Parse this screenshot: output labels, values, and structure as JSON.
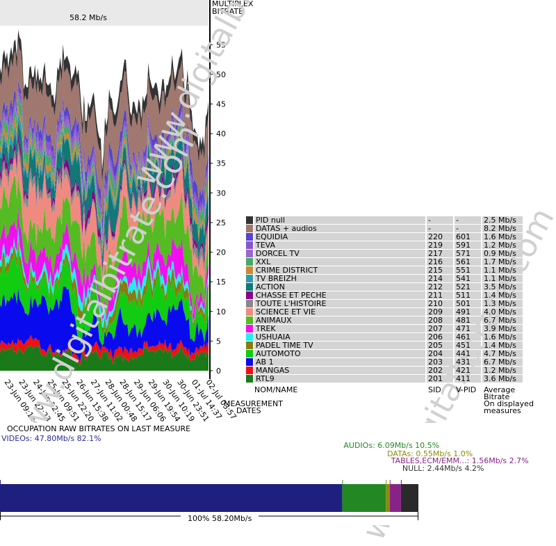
{
  "chart_data": {
    "type": "area",
    "title": "58.2 Mb/s",
    "ylabel": "MULTIPLEX\nBITRATE",
    "xlabel": "MEASUREMENT\nDATES",
    "ylim": [
      0,
      58.2
    ],
    "yticks": [
      0,
      5,
      10,
      15,
      20,
      25,
      30,
      35,
      40,
      45,
      50,
      55
    ],
    "x": [
      "23-Jun 09:16",
      "23-Jun 22:23",
      "24-Jun 12:45",
      "25-Jun 09:51",
      "25-Jun 22:20",
      "26-Jun 15:38",
      "27-Jun 11:02",
      "28-Jun 00:48",
      "28-Jun 15:17",
      "29-Jun 06:06",
      "29-Jun 19:54",
      "30-Jun 10:19",
      "30-Jun 23:51",
      "01-Jul 14:37",
      "02-Jul 03:57"
    ],
    "series": [
      {
        "name": "RTL9",
        "sid": "201",
        "vpid": "411",
        "avg": "3.6 Mb/s",
        "color": "#1a7a1a",
        "value": 3.6
      },
      {
        "name": "MANGAS",
        "sid": "202",
        "vpid": "421",
        "avg": "1.2 Mb/s",
        "color": "#ee1111",
        "value": 1.2
      },
      {
        "name": "AB 1",
        "sid": "203",
        "vpid": "431",
        "avg": "6.7 Mb/s",
        "color": "#0a0aee",
        "value": 6.7
      },
      {
        "name": "AUTOMOTO",
        "sid": "204",
        "vpid": "441",
        "avg": "4.7 Mb/s",
        "color": "#11cc11",
        "value": 4.7
      },
      {
        "name": "PADEL TIME TV",
        "sid": "205",
        "vpid": "451",
        "avg": "1.4 Mb/s",
        "color": "#8a7a10",
        "value": 1.4
      },
      {
        "name": "USHUAIA",
        "sid": "206",
        "vpid": "461",
        "avg": "1.6 Mb/s",
        "color": "#22eeee",
        "value": 1.6
      },
      {
        "name": "TREK",
        "sid": "207",
        "vpid": "471",
        "avg": "3.9 Mb/s",
        "color": "#ee11ee",
        "value": 3.9
      },
      {
        "name": "ANIMAUX",
        "sid": "208",
        "vpid": "481",
        "avg": "6.7 Mb/s",
        "color": "#55bb22",
        "value": 6.7
      },
      {
        "name": "SCIENCE ET VIE",
        "sid": "209",
        "vpid": "491",
        "avg": "4.0 Mb/s",
        "color": "#f08a80",
        "value": 4.0
      },
      {
        "name": "TOUTE L'HISTOIRE",
        "sid": "210",
        "vpid": "501",
        "avg": "1.3 Mb/s",
        "color": "#888888",
        "value": 1.3
      },
      {
        "name": "CHASSE ET PECHE",
        "sid": "211",
        "vpid": "511",
        "avg": "1.4 Mb/s",
        "color": "#880088",
        "value": 1.4
      },
      {
        "name": "ACTION",
        "sid": "212",
        "vpid": "521",
        "avg": "3.5 Mb/s",
        "color": "#117777",
        "value": 3.5
      },
      {
        "name": "TV BREIZH",
        "sid": "214",
        "vpid": "541",
        "avg": "1.1 Mb/s",
        "color": "#3399aa",
        "value": 1.1
      },
      {
        "name": "CRIME DISTRICT",
        "sid": "215",
        "vpid": "551",
        "avg": "1.1 Mb/s",
        "color": "#cc8833",
        "value": 1.1
      },
      {
        "name": "XXL",
        "sid": "216",
        "vpid": "561",
        "avg": "1.7 Mb/s",
        "color": "#44aa66",
        "value": 1.7
      },
      {
        "name": "DORCEL TV",
        "sid": "217",
        "vpid": "571",
        "avg": "0.9 Mb/s",
        "color": "#9966cc",
        "value": 0.9
      },
      {
        "name": "TEVA",
        "sid": "219",
        "vpid": "591",
        "avg": "1.2 Mb/s",
        "color": "#8855cc",
        "value": 1.2
      },
      {
        "name": "EQUIDIA",
        "sid": "220",
        "vpid": "601",
        "avg": "1.6 Mb/s",
        "color": "#5544cc",
        "value": 1.6
      },
      {
        "name": "DATAS + audios",
        "sid": "-",
        "vpid": "-",
        "avg": "8.2 Mb/s",
        "color": "#a07870",
        "value": 8.2
      },
      {
        "name": "PID null",
        "sid": "-",
        "vpid": "-",
        "avg": "2.5 Mb/s",
        "color": "#333333",
        "value": 2.5
      }
    ]
  },
  "legend_header": {
    "name": "NOM/NAME",
    "sid": "SID",
    "vpid": "V-PID",
    "avg": "Average\nBitrate\nOn displayed\nmeasures"
  },
  "watermark": "www.digitalbitrate.com",
  "occupation": {
    "title": "OCCUPATION RAW BITRATES ON LAST MEASURE",
    "total_label": "100%   58.20Mb/s",
    "segments": [
      {
        "label": "VIDEOs: 47.80Mb/s  82.1%",
        "value": 47.8,
        "color": "#1f1f80",
        "text_color": "#2a2a99"
      },
      {
        "label": "AUDIOs: 6.09Mb/s  10.5%",
        "value": 6.09,
        "color": "#238823",
        "text_color": "#238823"
      },
      {
        "label": "DATAs: 0.55Mb/s  1.0%",
        "value": 0.55,
        "color": "#8a8a10",
        "text_color": "#8a8a10"
      },
      {
        "label": "TABLES,ECM/EMM...: 1.56Mb/s  2.7%",
        "value": 1.56,
        "color": "#882288",
        "text_color": "#882288"
      },
      {
        "label": "NULL: 2.44Mb/s  4.2%",
        "value": 2.44,
        "color": "#2a2a2a",
        "text_color": "#333333"
      }
    ]
  }
}
